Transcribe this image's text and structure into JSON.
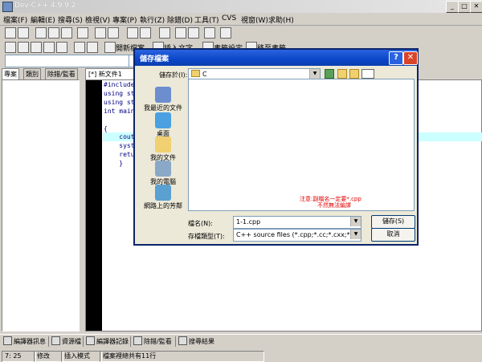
{
  "app": {
    "title": "Dev-C++ 4.9.9.2"
  },
  "menu": [
    "檔案(F)",
    "編輯(E)",
    "搜尋(S)",
    "檢視(V)",
    "專案(P)",
    "執行(Z)",
    "除錯(D)",
    "工具(T)",
    "CVS",
    "視窗(W)",
    "求助(H)"
  ],
  "toolbar2": {
    "new_project": "開新檔案",
    "insert_text": "插入文字",
    "bookmark_set": "書籤設定",
    "bookmark_goto": "移至書籤"
  },
  "left_tabs": [
    "專案",
    "類別",
    "除錯/監看"
  ],
  "editor": {
    "tab": "[*] 新文件1",
    "lines": [
      "#include",
      "using st",
      "using st",
      "int main",
      "",
      "{",
      "    cout",
      "    syst",
      "    retu",
      "    }"
    ]
  },
  "bottom_tabs": [
    "編譯器訊息",
    "資源檔",
    "編譯器記錄",
    "除錯/監看",
    "搜尋結果"
  ],
  "status": {
    "pos": "7: 25",
    "modified": "修改",
    "mode": "插入模式",
    "lines": "檔案裡總共有11行"
  },
  "dialog": {
    "title": "儲存檔案",
    "save_in_label": "儲存於(I):",
    "save_in_value": "C",
    "places": [
      "我最近的文件",
      "桌面",
      "我的文件",
      "我的電腦",
      "網路上的芳鄰"
    ],
    "note_line1": "注意:副檔名一定要*.cpp",
    "note_line2": "不然無法編譯",
    "filename_label": "檔名(N):",
    "filename_value": "1-1.cpp",
    "filetype_label": "存檔類型(T):",
    "filetype_value": "C++ source files (*.cpp;*.cc;*.cxx;*.c++;*.cp)",
    "save_button": "儲存(S)",
    "cancel_button": "取消",
    "help_button": "?",
    "close_button": "✕"
  }
}
